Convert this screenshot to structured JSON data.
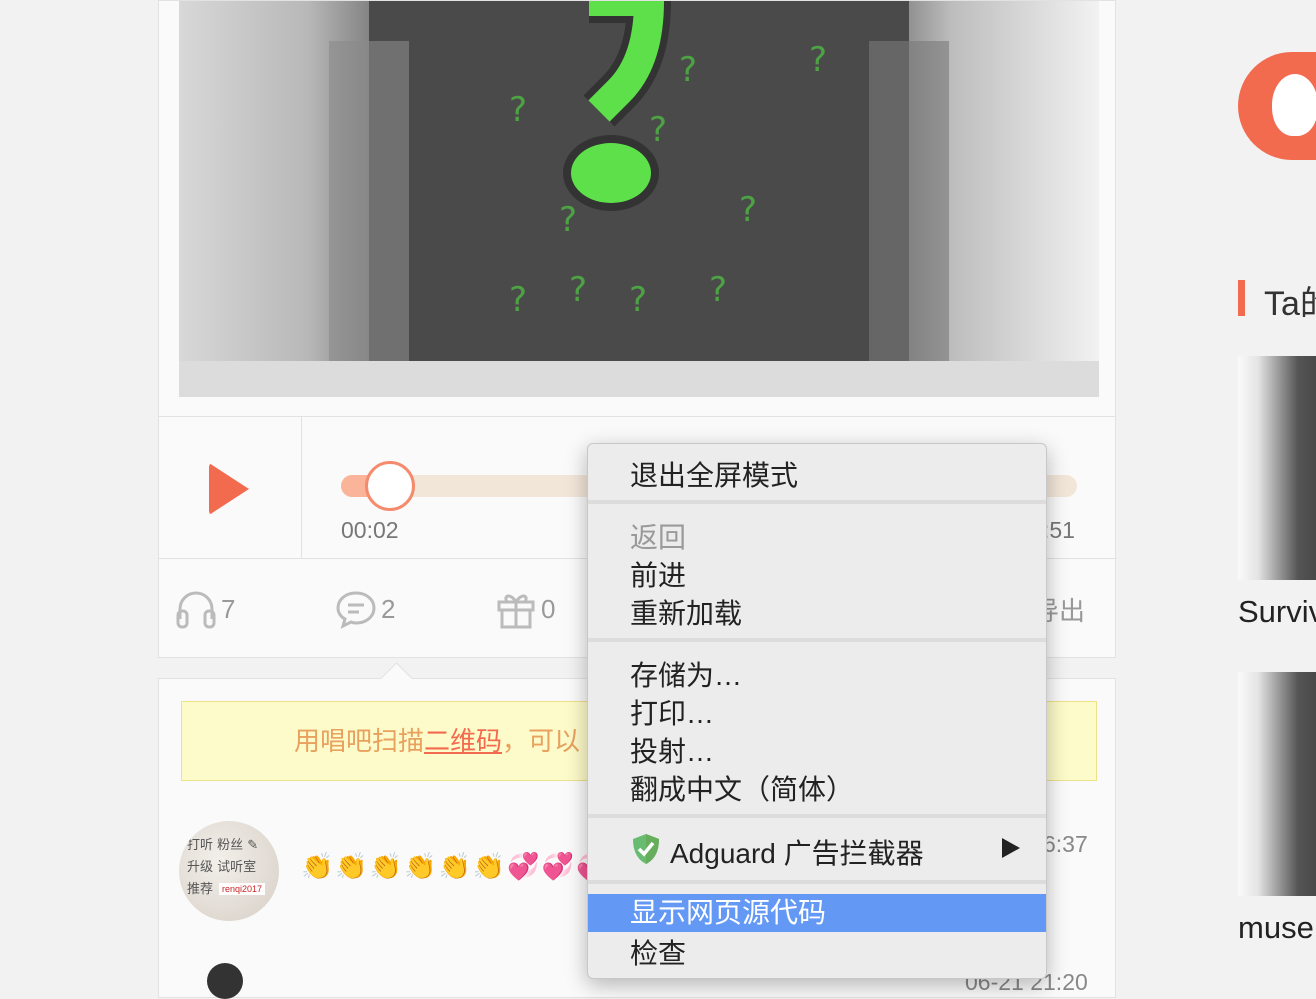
{
  "player": {
    "current_time": "00:02",
    "total_time_partial": ":51",
    "progress_fraction": 0.05
  },
  "stats": {
    "listens": "7",
    "comments": "2",
    "gifts": "0",
    "export_partial": "导出"
  },
  "notice": {
    "text_before": "用唱吧扫描",
    "link": "二维码",
    "text_after": "，可以"
  },
  "comments": [
    {
      "avatar_text": "renqi2017",
      "emoji": "👏👏👏👏👏👏💞💞💞",
      "time_partial": "6:37"
    },
    {
      "time_partial": "06-21 21:20"
    }
  ],
  "sidebar": {
    "title_partial": "Ta的",
    "items": [
      {
        "label_partial": "Surviv"
      },
      {
        "label_partial": "muse"
      }
    ]
  },
  "context_menu": {
    "group1": [
      "退出全屏模式"
    ],
    "group2": [
      {
        "label": "返回",
        "disabled": true
      },
      {
        "label": "前进",
        "disabled": false
      },
      {
        "label": "重新加载",
        "disabled": false
      }
    ],
    "group3": [
      "存储为…",
      "打印…",
      "投射…",
      "翻成中文（简体）"
    ],
    "extension": {
      "label": "Adguard 广告拦截器",
      "icon": "shield-check-icon",
      "has_submenu": true
    },
    "group5": [
      {
        "label": "显示网页源代码",
        "highlighted": true
      },
      {
        "label": "检查",
        "highlighted": false
      }
    ]
  },
  "colors": {
    "accent": "#f26b4f",
    "highlight": "#6398f5",
    "notice_bg": "#fdfbc9",
    "neon_green": "#5ee04a"
  }
}
